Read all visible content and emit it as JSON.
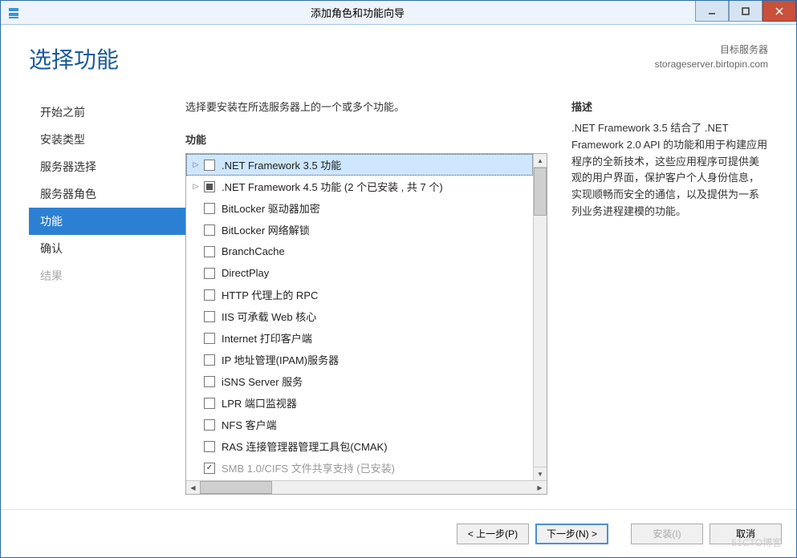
{
  "window": {
    "title": "添加角色和功能向导"
  },
  "header": {
    "page_title": "选择功能",
    "dest_label": "目标服务器",
    "dest_value": "storageserver.birtopin.com"
  },
  "sidebar": {
    "items": [
      {
        "label": "开始之前",
        "state": "normal"
      },
      {
        "label": "安装类型",
        "state": "normal"
      },
      {
        "label": "服务器选择",
        "state": "normal"
      },
      {
        "label": "服务器角色",
        "state": "normal"
      },
      {
        "label": "功能",
        "state": "active"
      },
      {
        "label": "确认",
        "state": "normal"
      },
      {
        "label": "结果",
        "state": "disabled"
      }
    ]
  },
  "center": {
    "instruction": "选择要安装在所选服务器上的一个或多个功能。",
    "section_label": "功能",
    "features": [
      {
        "label": ".NET Framework 3.5 功能",
        "expandable": true,
        "check": "unchecked",
        "selected": true
      },
      {
        "label": ".NET Framework 4.5 功能 (2 个已安装 , 共 7 个)",
        "expandable": true,
        "check": "partial"
      },
      {
        "label": "BitLocker 驱动器加密",
        "check": "unchecked"
      },
      {
        "label": "BitLocker 网络解锁",
        "check": "unchecked"
      },
      {
        "label": "BranchCache",
        "check": "unchecked"
      },
      {
        "label": "DirectPlay",
        "check": "unchecked"
      },
      {
        "label": "HTTP 代理上的 RPC",
        "check": "unchecked"
      },
      {
        "label": "IIS 可承载 Web 核心",
        "check": "unchecked"
      },
      {
        "label": "Internet 打印客户端",
        "check": "unchecked"
      },
      {
        "label": "IP 地址管理(IPAM)服务器",
        "check": "unchecked"
      },
      {
        "label": "iSNS Server 服务",
        "check": "unchecked"
      },
      {
        "label": "LPR 端口监视器",
        "check": "unchecked"
      },
      {
        "label": "NFS 客户端",
        "check": "unchecked"
      },
      {
        "label": "RAS 连接管理器管理工具包(CMAK)",
        "check": "unchecked"
      },
      {
        "label": "SMB 1.0/CIFS 文件共享支持 (已安装)",
        "check": "checked",
        "disabled": true
      }
    ]
  },
  "right": {
    "section_label": "描述",
    "description": ".NET Framework 3.5 结合了 .NET Framework 2.0 API 的功能和用于构建应用程序的全新技术，这些应用程序可提供美观的用户界面，保护客户个人身份信息，实现顺畅而安全的通信，以及提供为一系列业务进程建模的功能。"
  },
  "footer": {
    "prev": "< 上一步(P)",
    "next": "下一步(N) >",
    "install": "安装(I)",
    "cancel": "取消"
  },
  "watermark": "51CTO博客"
}
